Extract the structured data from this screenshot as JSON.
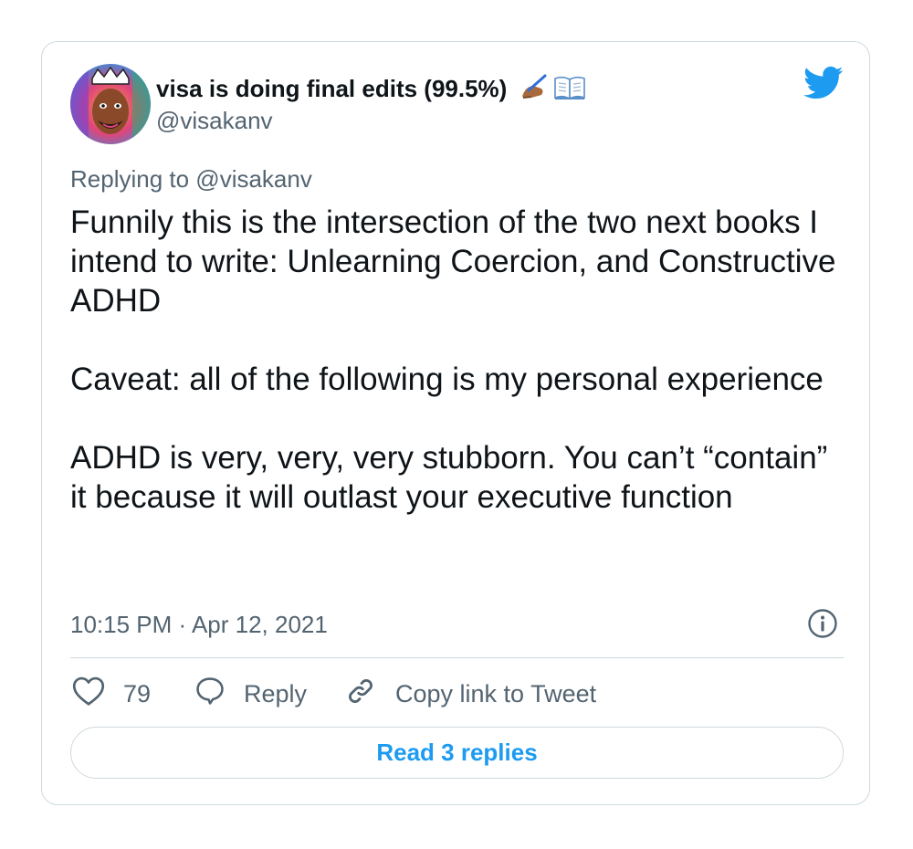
{
  "author": {
    "display_name": "visa is doing final edits (99.5%)",
    "handle": "@visakanv"
  },
  "replying_to": "Replying to @visakanv",
  "tweet": {
    "paragraphs": [
      "Funnily this is the intersection of the two next books I intend to write: Unlearning Coercion, and Constructive ADHD",
      "Caveat: all of the following is my personal experience",
      "ADHD is very, very, very stubborn. You can’t “contain” it because it will outlast your executive function"
    ]
  },
  "timestamp": "10:15 PM · Apr 12, 2021",
  "actions": {
    "like_count": "79",
    "reply_label": "Reply",
    "copy_link_label": "Copy link to Tweet"
  },
  "read_replies_label": "Read 3 replies",
  "icons": {
    "avatar": "avatar",
    "emoji_writing": "writing-hand-icon",
    "emoji_book": "open-book-icon",
    "brand": "twitter-bird-icon",
    "info": "info-icon",
    "like": "heart-icon",
    "reply": "comment-bubble-icon",
    "copy": "link-icon"
  },
  "colors": {
    "brand": "#1d9bf0",
    "secondary_text": "#536471",
    "primary_text": "#0f1419",
    "border": "#cfd9de"
  }
}
